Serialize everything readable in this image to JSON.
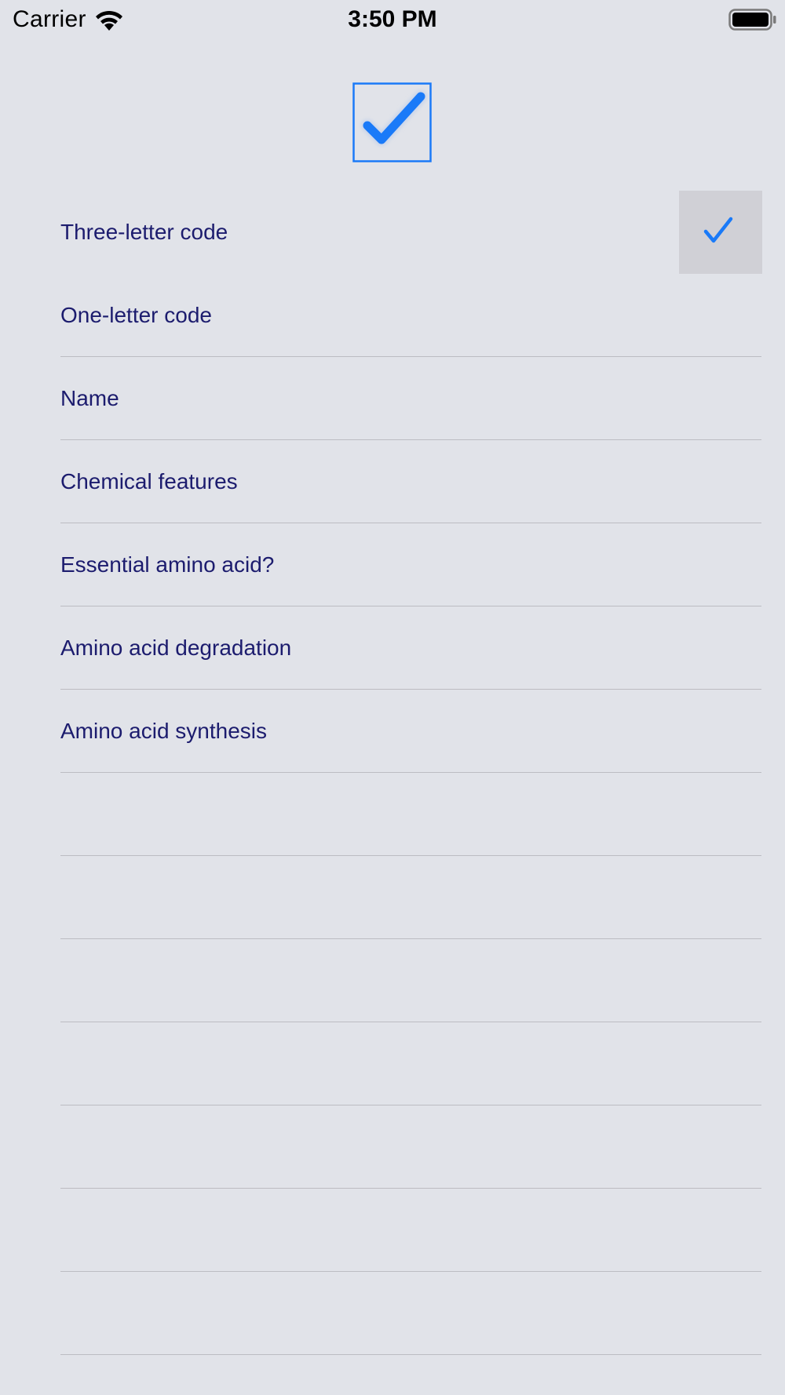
{
  "status_bar": {
    "carrier": "Carrier",
    "time": "3:50 PM",
    "wifi_icon": "wifi-icon",
    "battery_icon": "battery-icon"
  },
  "header": {
    "icon": "checkbox-checked-icon"
  },
  "accent_color": "#1a7af8",
  "list": {
    "items": [
      {
        "label": "Three-letter code",
        "selected": true
      },
      {
        "label": "One-letter code",
        "selected": false
      },
      {
        "label": "Name",
        "selected": false
      },
      {
        "label": "Chemical features",
        "selected": false
      },
      {
        "label": "Essential amino acid?",
        "selected": false
      },
      {
        "label": "Amino acid degradation",
        "selected": false
      },
      {
        "label": "Amino acid synthesis",
        "selected": false
      },
      {
        "label": "",
        "selected": false
      },
      {
        "label": "",
        "selected": false
      },
      {
        "label": "",
        "selected": false
      },
      {
        "label": "",
        "selected": false
      },
      {
        "label": "",
        "selected": false
      },
      {
        "label": "",
        "selected": false
      },
      {
        "label": "",
        "selected": false
      }
    ]
  }
}
